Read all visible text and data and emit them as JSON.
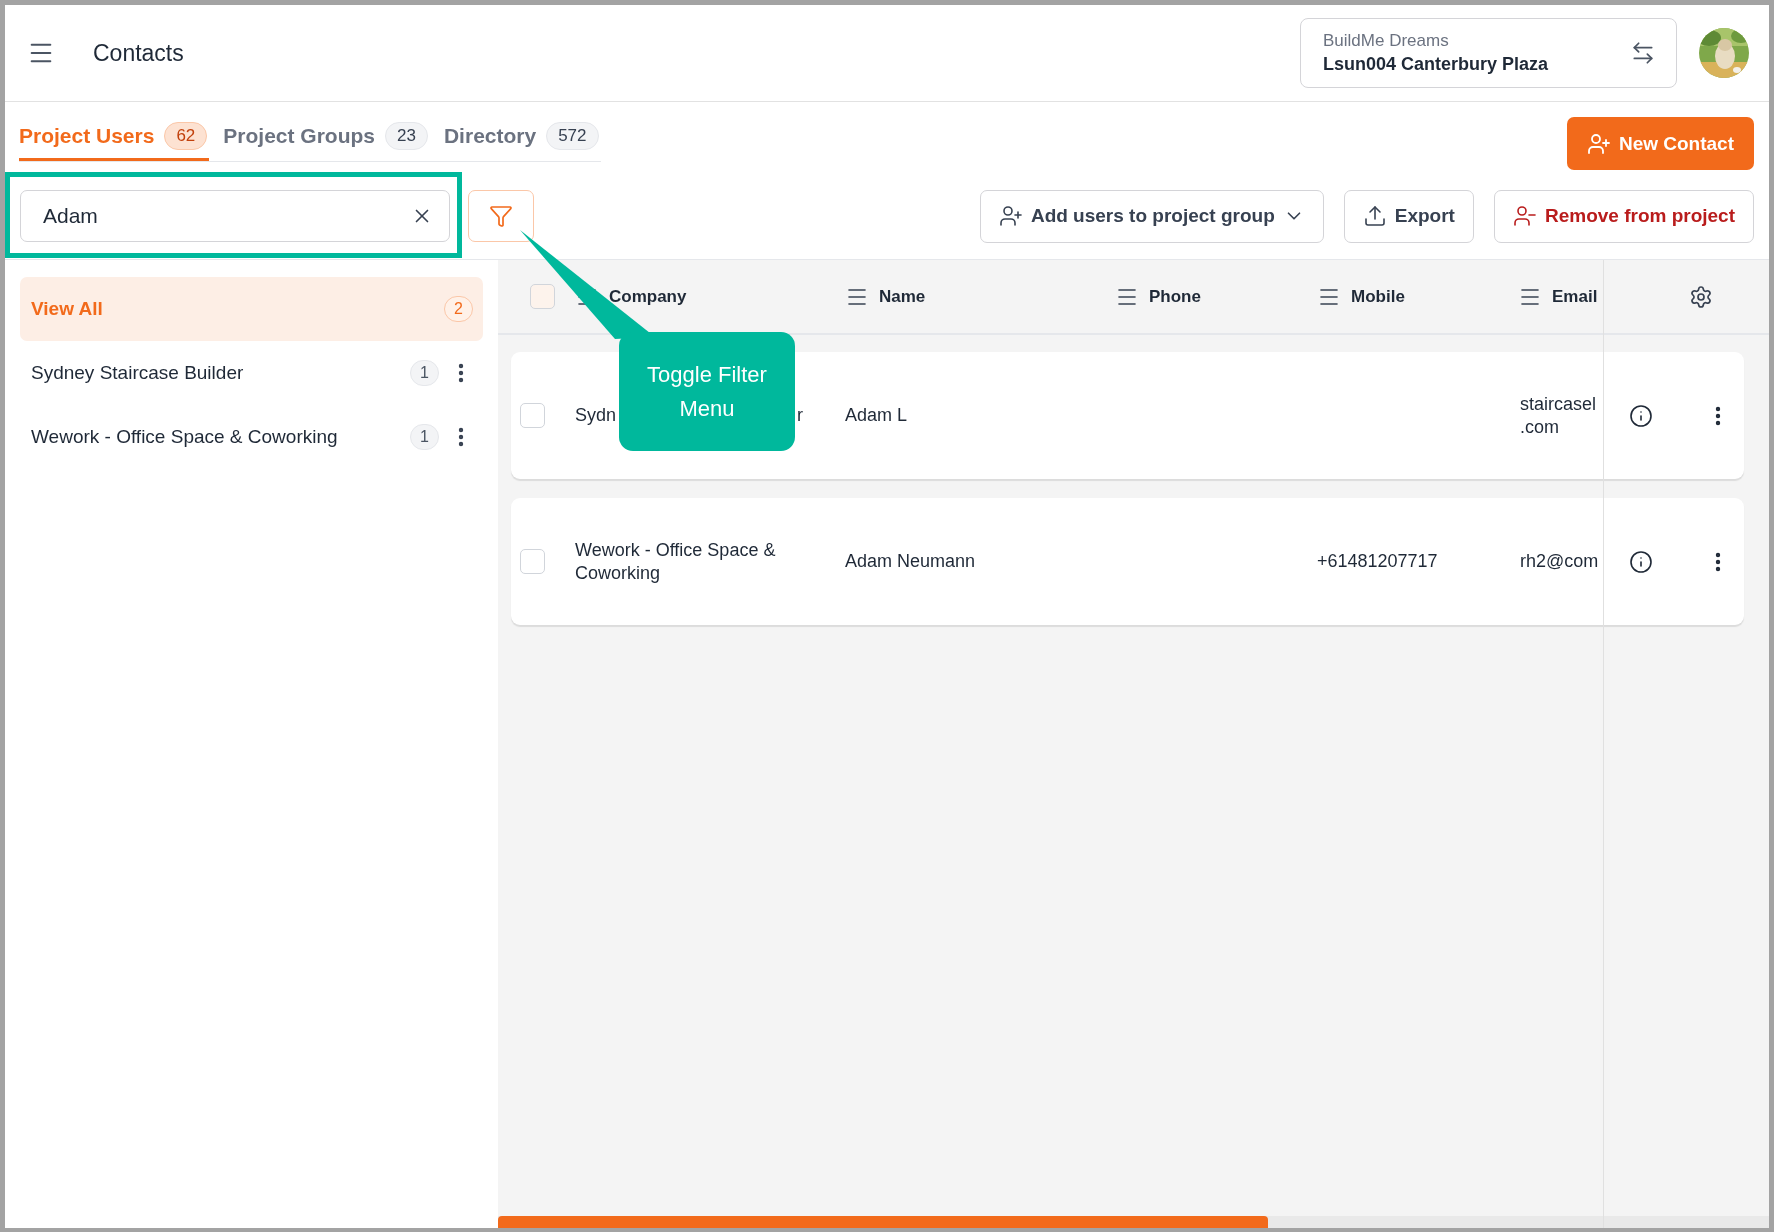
{
  "header": {
    "title": "Contacts",
    "org": "BuildMe Dreams",
    "project": "Lsun004 Canterbury Plaza"
  },
  "tabs": [
    {
      "label": "Project Users",
      "count": "62",
      "selected": true
    },
    {
      "label": "Project Groups",
      "count": "23",
      "selected": false
    },
    {
      "label": "Directory",
      "count": "572",
      "selected": false
    }
  ],
  "new_contact_button": "New Contact",
  "search": {
    "value": "Adam"
  },
  "toolbar": {
    "add_to_group": "Add users to project group",
    "export": "Export",
    "remove": "Remove from project"
  },
  "sidebar": {
    "items": [
      {
        "label": "View All",
        "count": "2",
        "selected": true,
        "has_menu": false
      },
      {
        "label": "Sydney Staircase Builder",
        "count": "1",
        "selected": false,
        "has_menu": true
      },
      {
        "label": "Wework - Office Space & Coworking",
        "count": "1",
        "selected": false,
        "has_menu": true
      }
    ]
  },
  "table": {
    "header_checked": false,
    "columns": [
      "Company",
      "Name",
      "Phone",
      "Mobile",
      "Email"
    ],
    "rows": [
      {
        "checked": false,
        "company": [
          "Sydn",
          "r"
        ],
        "name": "Adam L",
        "email_lines": [
          "staircasel",
          ".com"
        ]
      },
      {
        "checked": false,
        "company": [
          "Wework - Office Space & Coworking"
        ],
        "name": "Adam Neumann",
        "mobile": "+61481207717",
        "email_lines": [
          "rh2@com"
        ]
      }
    ]
  },
  "callout": {
    "text": "Toggle Filter Menu"
  }
}
